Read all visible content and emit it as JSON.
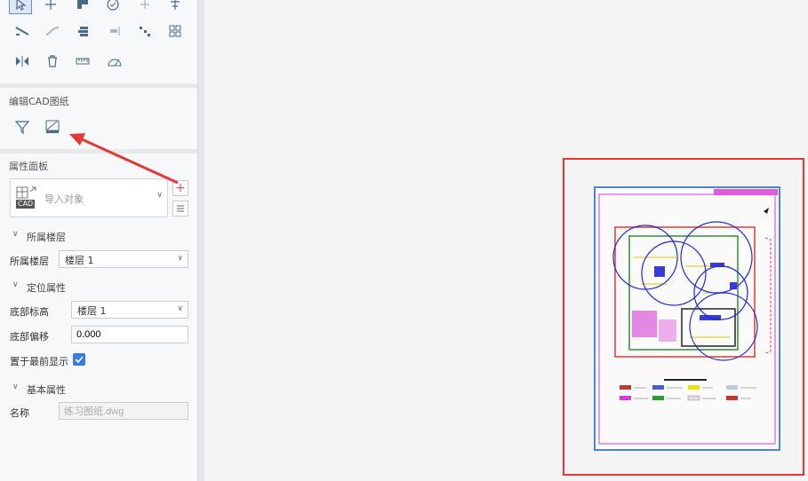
{
  "sidebar": {
    "cad_edit_title": "编辑CAD图纸",
    "property_panel_title": "属性面板",
    "import_object": {
      "icon_label": "CAD",
      "placeholder": "导入对象"
    },
    "floor_group": {
      "title": "所属楼层",
      "label": "所属楼层",
      "value": "楼层 1"
    },
    "position_group": {
      "title": "定位属性",
      "base_elevation": {
        "label": "底部标高",
        "value": "楼层 1"
      },
      "base_offset": {
        "label": "底部偏移",
        "value": "0.000"
      },
      "bring_front": {
        "label": "置于最前显示",
        "checked": true
      }
    },
    "basic_group": {
      "title": "基本属性",
      "name": {
        "label": "名称",
        "value": "练习图纸.dwg"
      }
    }
  },
  "tool_icons": [
    "select-icon",
    "move-icon",
    "wall-icon",
    "circle-check-icon",
    "crosshair-icon",
    "align-icon",
    "diagonal-icon",
    "curve-icon",
    "stack-icon",
    "split-icon",
    "scatter-icon",
    "grid-icon",
    "mirror-icon",
    "trash-icon",
    "ruler-icon",
    "protractor-icon"
  ],
  "colors": {
    "accent": "#4a86d8",
    "highlight_red": "#e53935",
    "drawing_blue": "#1f2bd6"
  }
}
